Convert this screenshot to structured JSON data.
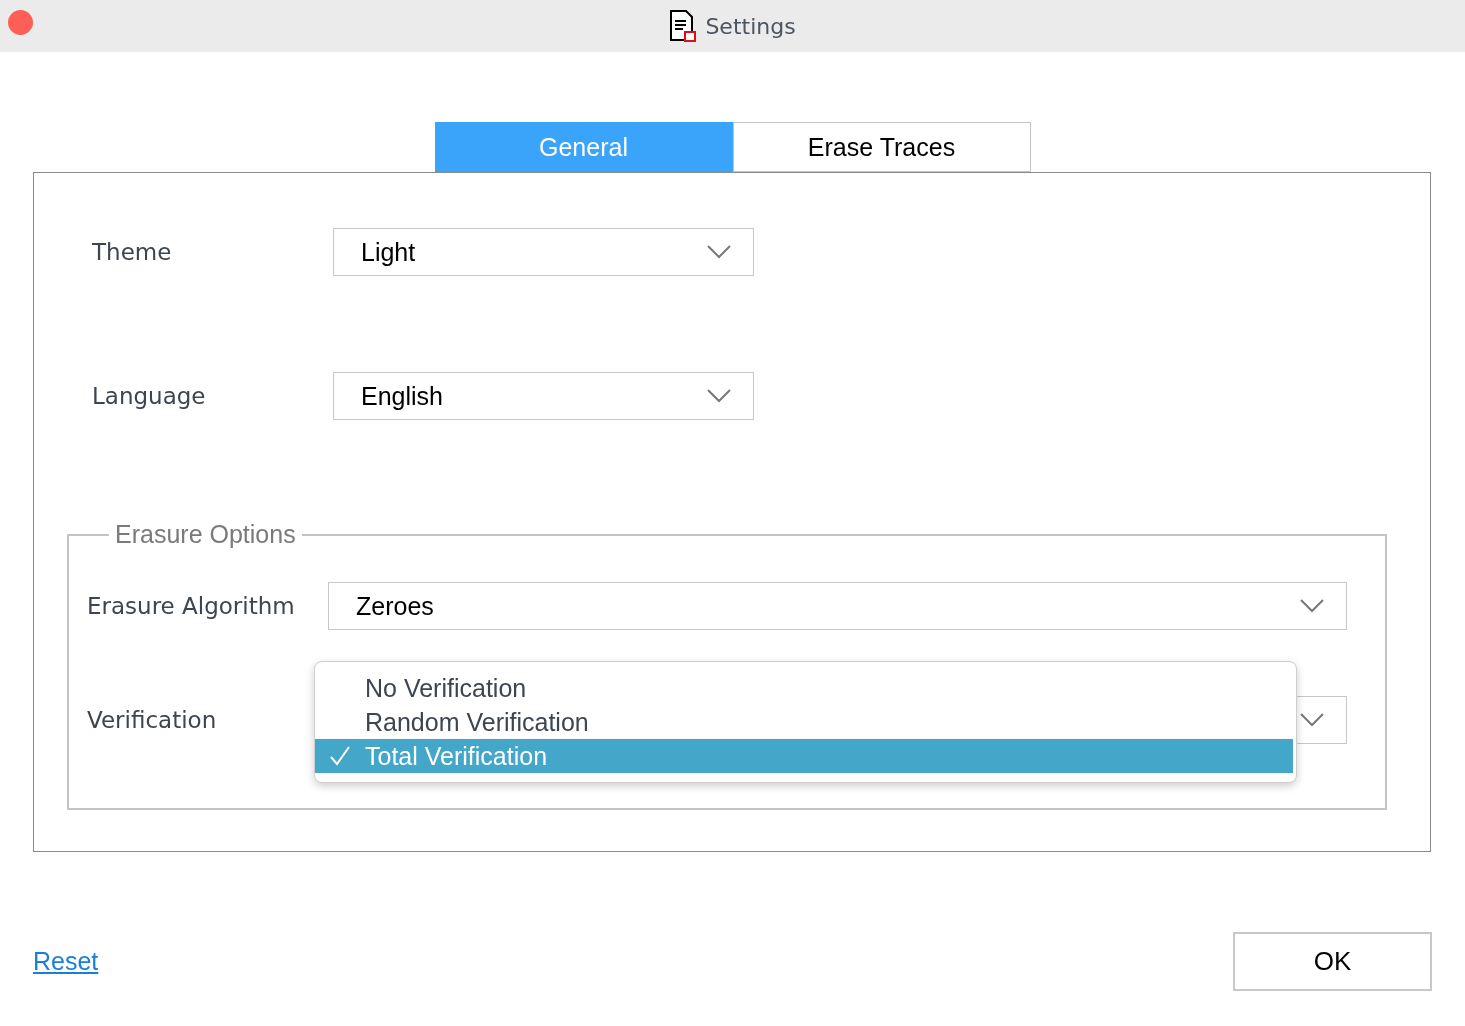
{
  "window": {
    "title": "Settings"
  },
  "tabs": [
    {
      "label": "General",
      "selected": true
    },
    {
      "label": "Erase Traces",
      "selected": false
    }
  ],
  "settings": [
    {
      "label": "Theme",
      "value": "Light"
    },
    {
      "label": "Language",
      "value": "English"
    }
  ],
  "erasure_options": {
    "title": "Erasure Options",
    "algorithm": {
      "label": "Erasure Algorithm",
      "value": "Zeroes"
    },
    "verification": {
      "label": "Verification",
      "expanded": true,
      "options": [
        {
          "label": "No Verification",
          "selected": false
        },
        {
          "label": "Random Verification",
          "selected": false
        },
        {
          "label": "Total Verification",
          "selected": true
        }
      ]
    }
  },
  "reset_link": "Reset",
  "ok_button": "OK"
}
